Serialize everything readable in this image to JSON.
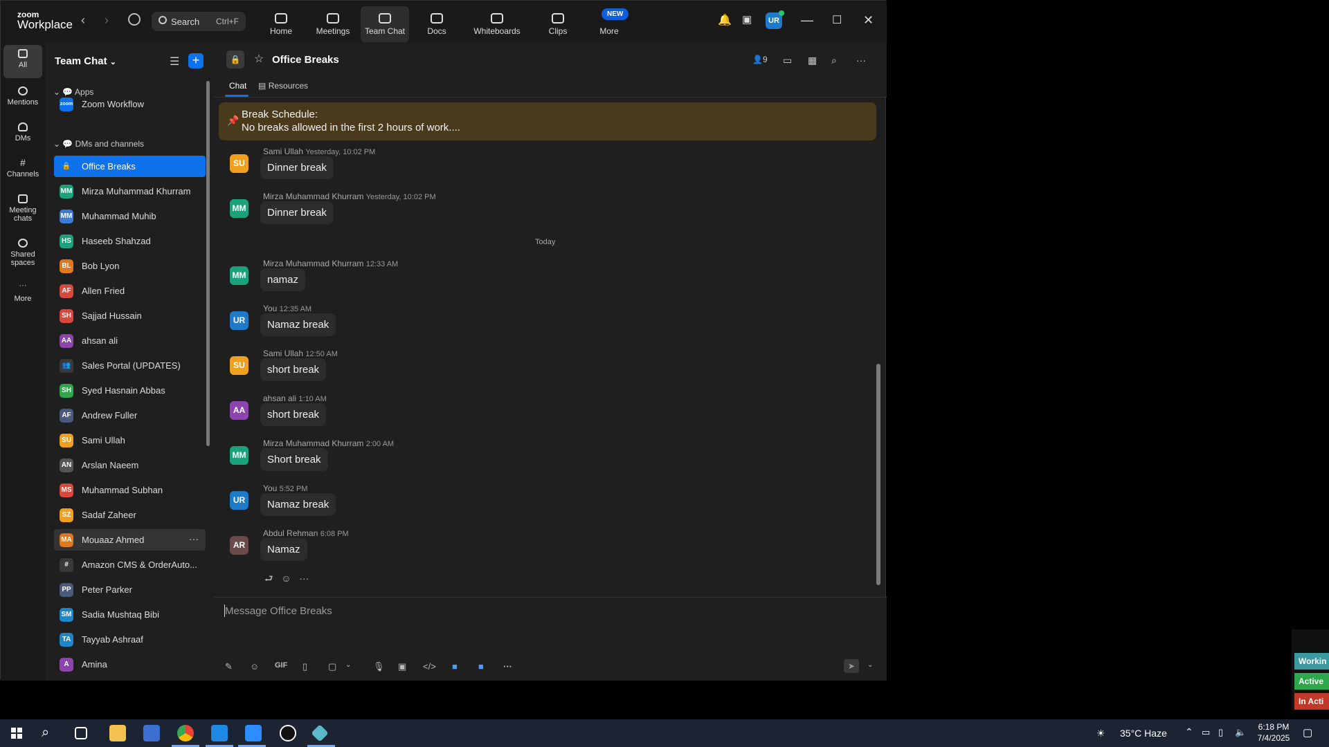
{
  "topbar": {
    "logo_line1": "zoom",
    "logo_line2": "Workplace",
    "search_label": "Search",
    "search_shortcut": "Ctrl+F",
    "nav": [
      {
        "label": "Home"
      },
      {
        "label": "Meetings"
      },
      {
        "label": "Team Chat"
      },
      {
        "label": "Docs"
      },
      {
        "label": "Whiteboards"
      },
      {
        "label": "Clips"
      },
      {
        "label": "More"
      }
    ],
    "new_badge": "NEW",
    "user_initials": "UR"
  },
  "rail": [
    {
      "label": "All"
    },
    {
      "label": "Mentions"
    },
    {
      "label": "DMs"
    },
    {
      "label": "Channels"
    },
    {
      "label": "Meeting chats"
    },
    {
      "label": "Shared spaces"
    },
    {
      "label": "More"
    }
  ],
  "sidebar": {
    "title": "Team Chat",
    "section_apps": "Apps",
    "section_dms": "DMs and channels",
    "items": [
      {
        "initials": "zoom",
        "name": "Zoom Workflow",
        "color": "#0e72ed"
      },
      {
        "initials": "🔒",
        "name": "Office Breaks",
        "color": "#0e72ed"
      },
      {
        "initials": "MM",
        "name": "Mirza Muhammad Khurram",
        "color": "#1aa37a"
      },
      {
        "initials": "MM",
        "name": "Muhammad Muhib",
        "color": "#3d7bd9"
      },
      {
        "initials": "HS",
        "name": "Haseeb Shahzad",
        "color": "#1aa37a"
      },
      {
        "initials": "BL",
        "name": "Bob Lyon",
        "color": "#e0781f"
      },
      {
        "initials": "AF",
        "name": "Allen Fried",
        "color": "#d9483b"
      },
      {
        "initials": "SH",
        "name": "Sajjad Hussain",
        "color": "#d9483b"
      },
      {
        "initials": "AA",
        "name": "ahsan ali",
        "color": "#8e44ad"
      },
      {
        "initials": "👥",
        "name": "Sales Portal (UPDATES)",
        "color": "#3a3a3a"
      },
      {
        "initials": "SH",
        "name": "Syed Hasnain Abbas",
        "color": "#2ea84a"
      },
      {
        "initials": "AF",
        "name": "Andrew Fuller",
        "color": "#4a5a7a"
      },
      {
        "initials": "SU",
        "name": "Sami Ullah",
        "color": "#f0a020"
      },
      {
        "initials": "AN",
        "name": "Arslan Naeem",
        "color": "#555555"
      },
      {
        "initials": "MS",
        "name": "Muhammad Subhan",
        "color": "#d9483b"
      },
      {
        "initials": "SZ",
        "name": "Sadaf Zaheer",
        "color": "#f0a020"
      },
      {
        "initials": "MA",
        "name": "Mouaaz Ahmed",
        "color": "#e0781f"
      },
      {
        "initials": "#",
        "name": "Amazon CMS & OrderAuto...",
        "color": "#3a3a3a"
      },
      {
        "initials": "PP",
        "name": "Peter Parker",
        "color": "#4a5a7a"
      },
      {
        "initials": "SM",
        "name": "Sadia Mushtaq Bibi",
        "color": "#1f86c8"
      },
      {
        "initials": "TA",
        "name": "Tayyab Ashraaf",
        "color": "#1f86c8"
      },
      {
        "initials": "A",
        "name": "Amina",
        "color": "#8e44ad"
      }
    ]
  },
  "channel": {
    "name": "Office Breaks",
    "member_count": "9",
    "tabs": [
      "Chat",
      "Resources"
    ]
  },
  "pinned": {
    "line1": "Break Schedule:",
    "line2": "No breaks allowed in the first 2 hours of work...."
  },
  "divider_today": "Today",
  "messages": [
    {
      "initials": "SU",
      "color": "#f0a020",
      "sender": "Sami Ullah",
      "time": "Yesterday, 10:02 PM",
      "text": "Dinner break"
    },
    {
      "initials": "MM",
      "color": "#1aa37a",
      "sender": "Mirza Muhammad Khurram",
      "time": "Yesterday, 10:02 PM",
      "text": "Dinner break"
    },
    {
      "initials": "MM",
      "color": "#1aa37a",
      "sender": "Mirza Muhammad Khurram",
      "time": "12:33 AM",
      "text": "namaz"
    },
    {
      "initials": "UR",
      "color": "#1f7ac8",
      "sender": "You",
      "time": "12:35 AM",
      "text": "Namaz break"
    },
    {
      "initials": "SU",
      "color": "#f0a020",
      "sender": "Sami Ullah",
      "time": "12:50 AM",
      "text": "short break"
    },
    {
      "initials": "AA",
      "color": "#8e44ad",
      "sender": "ahsan ali",
      "time": "1:10 AM",
      "text": "short break"
    },
    {
      "initials": "MM",
      "color": "#1aa37a",
      "sender": "Mirza Muhammad Khurram",
      "time": "2:00 AM",
      "text": "Short break"
    },
    {
      "initials": "UR",
      "color": "#1f7ac8",
      "sender": "You",
      "time": "5:52 PM",
      "text": "Namaz break"
    },
    {
      "initials": "AR",
      "color": "#6b4a4a",
      "sender": "Abdul Rehman",
      "time": "6:08 PM",
      "text": "Namaz"
    }
  ],
  "composer": {
    "placeholder": "Message Office Breaks",
    "gif_label": "GIF"
  },
  "right_tags": [
    {
      "label": "Workin",
      "color": "#3a9aa0"
    },
    {
      "label": "Active",
      "color": "#2ea84a"
    },
    {
      "label": "In Acti",
      "color": "#c0392b"
    }
  ],
  "taskbar": {
    "weather": "35°C  Haze",
    "time": "6:18 PM",
    "date": "7/4/2025"
  }
}
